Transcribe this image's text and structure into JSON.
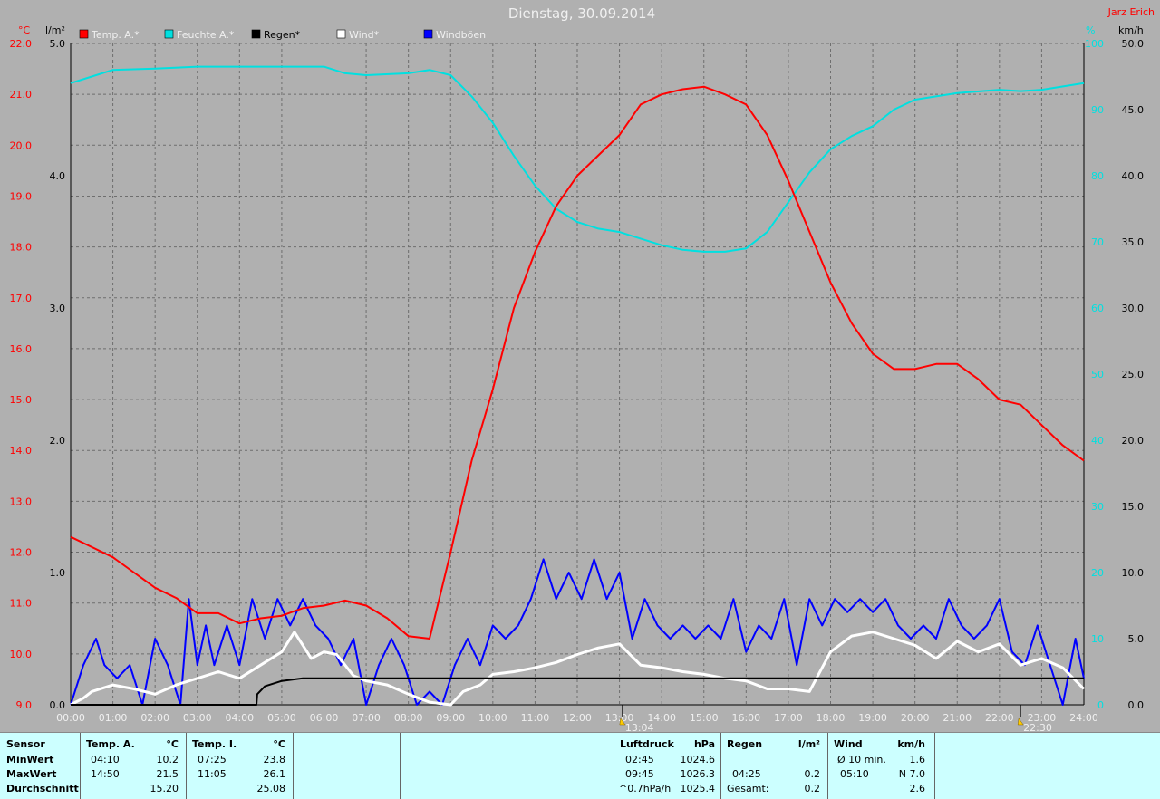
{
  "title": "Dienstag, 30.09.2014",
  "author": "Jarz Erich",
  "axes": {
    "left_unit": "°C",
    "left2_unit": "l/m²",
    "right_unit": "%",
    "right2_unit": "km/h",
    "temp_ticks": [
      "22.0",
      "21.0",
      "20.0",
      "19.0",
      "18.0",
      "17.0",
      "16.0",
      "15.0",
      "14.0",
      "13.0",
      "12.0",
      "11.0",
      "10.0",
      "9.0"
    ],
    "rain_ticks": [
      "5.0",
      "4.0",
      "3.0",
      "2.0",
      "1.0",
      "0.0"
    ],
    "hum_ticks": [
      "100",
      "90",
      "80",
      "70",
      "60",
      "50",
      "40",
      "30",
      "20",
      "10",
      "0"
    ],
    "wind_ticks": [
      "50.0",
      "45.0",
      "40.0",
      "35.0",
      "30.0",
      "25.0",
      "20.0",
      "15.0",
      "10.0",
      "5.0",
      "0.0"
    ],
    "time_ticks": [
      "00:00",
      "01:00",
      "02:00",
      "03:00",
      "04:00",
      "05:00",
      "06:00",
      "07:00",
      "08:00",
      "09:00",
      "10:00",
      "11:00",
      "12:00",
      "13:00",
      "14:00",
      "15:00",
      "16:00",
      "17:00",
      "18:00",
      "19:00",
      "20:00",
      "21:00",
      "22:00",
      "23:00",
      "24:00"
    ]
  },
  "markers": [
    {
      "time": 13.07,
      "label": "13:04"
    },
    {
      "time": 22.5,
      "label": "22:30"
    }
  ],
  "chart_data": {
    "type": "line",
    "title": "Dienstag, 30.09.2014",
    "x_unit": "hours",
    "xlim": [
      0,
      24
    ],
    "grid": true,
    "legend_position": "top",
    "series": [
      {
        "name": "Temp. A.*",
        "axis": "temp",
        "color": "#ff0000",
        "range": [
          9,
          22
        ],
        "points": [
          [
            0,
            12.3
          ],
          [
            0.5,
            12.1
          ],
          [
            1,
            11.9
          ],
          [
            1.5,
            11.6
          ],
          [
            2,
            11.3
          ],
          [
            2.5,
            11.1
          ],
          [
            3,
            10.8
          ],
          [
            3.5,
            10.8
          ],
          [
            4,
            10.6
          ],
          [
            4.5,
            10.7
          ],
          [
            5,
            10.75
          ],
          [
            5.5,
            10.9
          ],
          [
            6,
            10.95
          ],
          [
            6.5,
            11.05
          ],
          [
            7,
            10.95
          ],
          [
            7.5,
            10.7
          ],
          [
            8,
            10.35
          ],
          [
            8.5,
            10.3
          ],
          [
            9,
            12.0
          ],
          [
            9.5,
            13.8
          ],
          [
            10,
            15.2
          ],
          [
            10.5,
            16.8
          ],
          [
            11,
            17.9
          ],
          [
            11.5,
            18.8
          ],
          [
            12,
            19.4
          ],
          [
            12.5,
            19.8
          ],
          [
            13,
            20.2
          ],
          [
            13.5,
            20.8
          ],
          [
            14,
            21.0
          ],
          [
            14.5,
            21.1
          ],
          [
            15,
            21.15
          ],
          [
            15.5,
            21.0
          ],
          [
            16,
            20.8
          ],
          [
            16.5,
            20.2
          ],
          [
            17,
            19.3
          ],
          [
            17.5,
            18.3
          ],
          [
            18,
            17.3
          ],
          [
            18.5,
            16.5
          ],
          [
            19,
            15.9
          ],
          [
            19.5,
            15.6
          ],
          [
            20,
            15.6
          ],
          [
            20.5,
            15.7
          ],
          [
            21,
            15.7
          ],
          [
            21.5,
            15.4
          ],
          [
            22,
            15.0
          ],
          [
            22.5,
            14.9
          ],
          [
            23,
            14.5
          ],
          [
            23.5,
            14.1
          ],
          [
            24,
            13.8
          ]
        ]
      },
      {
        "name": "Feuchte A.*",
        "axis": "hum",
        "color": "#00e0e0",
        "range": [
          0,
          100
        ],
        "points": [
          [
            0,
            94
          ],
          [
            0.5,
            95
          ],
          [
            1,
            96
          ],
          [
            2,
            96.2
          ],
          [
            3,
            96.5
          ],
          [
            4,
            96.5
          ],
          [
            5,
            96.5
          ],
          [
            6,
            96.5
          ],
          [
            6.5,
            95.5
          ],
          [
            7,
            95.2
          ],
          [
            8,
            95.5
          ],
          [
            8.5,
            96
          ],
          [
            9,
            95.2
          ],
          [
            9.5,
            92
          ],
          [
            10,
            88
          ],
          [
            10.5,
            83
          ],
          [
            11,
            78.5
          ],
          [
            11.5,
            75
          ],
          [
            12,
            73
          ],
          [
            12.5,
            72
          ],
          [
            13,
            71.5
          ],
          [
            13.5,
            70.5
          ],
          [
            14,
            69.5
          ],
          [
            14.5,
            68.8
          ],
          [
            15,
            68.5
          ],
          [
            15.5,
            68.5
          ],
          [
            16,
            69
          ],
          [
            16.5,
            71.5
          ],
          [
            17,
            76
          ],
          [
            17.5,
            80.5
          ],
          [
            18,
            84
          ],
          [
            18.5,
            86
          ],
          [
            19,
            87.5
          ],
          [
            19.5,
            90
          ],
          [
            20,
            91.5
          ],
          [
            21,
            92.5
          ],
          [
            22,
            93
          ],
          [
            22.5,
            92.8
          ],
          [
            23,
            93
          ],
          [
            24,
            94
          ]
        ]
      },
      {
        "name": "Regen*",
        "axis": "rain",
        "color": "#000000",
        "range": [
          0,
          5
        ],
        "points": [
          [
            0,
            0
          ],
          [
            4.4,
            0
          ],
          [
            4.42,
            0.08
          ],
          [
            4.6,
            0.14
          ],
          [
            5,
            0.18
          ],
          [
            5.5,
            0.2
          ],
          [
            24,
            0.2
          ]
        ]
      },
      {
        "name": "Wind*",
        "axis": "wind",
        "color": "#ffffff",
        "range": [
          0,
          50
        ],
        "points": [
          [
            0,
            0
          ],
          [
            0.3,
            0.5
          ],
          [
            0.5,
            1
          ],
          [
            1,
            1.5
          ],
          [
            1.5,
            1.2
          ],
          [
            2,
            0.8
          ],
          [
            2.5,
            1.5
          ],
          [
            3,
            2
          ],
          [
            3.5,
            2.5
          ],
          [
            4,
            2
          ],
          [
            4.5,
            3
          ],
          [
            5,
            4
          ],
          [
            5.3,
            5.5
          ],
          [
            5.7,
            3.5
          ],
          [
            6,
            4
          ],
          [
            6.3,
            3.8
          ],
          [
            6.7,
            2.2
          ],
          [
            7,
            1.8
          ],
          [
            7.5,
            1.5
          ],
          [
            8,
            0.8
          ],
          [
            8.5,
            0.2
          ],
          [
            9,
            0
          ],
          [
            9.3,
            1
          ],
          [
            9.7,
            1.5
          ],
          [
            10,
            2.3
          ],
          [
            10.5,
            2.5
          ],
          [
            11,
            2.8
          ],
          [
            11.5,
            3.2
          ],
          [
            12,
            3.8
          ],
          [
            12.5,
            4.3
          ],
          [
            13,
            4.6
          ],
          [
            13.5,
            3
          ],
          [
            14,
            2.8
          ],
          [
            14.5,
            2.5
          ],
          [
            15,
            2.3
          ],
          [
            15.5,
            2
          ],
          [
            16,
            1.8
          ],
          [
            16.5,
            1.2
          ],
          [
            17,
            1.2
          ],
          [
            17.5,
            1
          ],
          [
            18,
            4
          ],
          [
            18.5,
            5.2
          ],
          [
            19,
            5.5
          ],
          [
            19.5,
            5
          ],
          [
            20,
            4.5
          ],
          [
            20.5,
            3.5
          ],
          [
            21,
            4.8
          ],
          [
            21.5,
            4
          ],
          [
            22,
            4.6
          ],
          [
            22.5,
            3
          ],
          [
            23,
            3.5
          ],
          [
            23.5,
            2.8
          ],
          [
            24,
            1.2
          ]
        ]
      },
      {
        "name": "Windböen",
        "axis": "wind",
        "color": "#0000ff",
        "range": [
          0,
          50
        ],
        "points": [
          [
            0,
            0
          ],
          [
            0.3,
            3
          ],
          [
            0.6,
            5
          ],
          [
            0.8,
            3
          ],
          [
            1.1,
            2
          ],
          [
            1.4,
            3
          ],
          [
            1.7,
            0
          ],
          [
            2.0,
            5
          ],
          [
            2.3,
            3
          ],
          [
            2.6,
            0
          ],
          [
            2.8,
            8
          ],
          [
            3.0,
            3
          ],
          [
            3.2,
            6
          ],
          [
            3.4,
            3
          ],
          [
            3.7,
            6
          ],
          [
            4.0,
            3
          ],
          [
            4.3,
            8
          ],
          [
            4.6,
            5
          ],
          [
            4.9,
            8
          ],
          [
            5.2,
            6
          ],
          [
            5.5,
            8
          ],
          [
            5.8,
            6
          ],
          [
            6.1,
            5
          ],
          [
            6.4,
            3
          ],
          [
            6.7,
            5
          ],
          [
            7.0,
            0
          ],
          [
            7.3,
            3
          ],
          [
            7.6,
            5
          ],
          [
            7.9,
            3
          ],
          [
            8.2,
            0
          ],
          [
            8.5,
            1
          ],
          [
            8.8,
            0
          ],
          [
            9.1,
            3
          ],
          [
            9.4,
            5
          ],
          [
            9.7,
            3
          ],
          [
            10.0,
            6
          ],
          [
            10.3,
            5
          ],
          [
            10.6,
            6
          ],
          [
            10.9,
            8
          ],
          [
            11.2,
            11
          ],
          [
            11.5,
            8
          ],
          [
            11.8,
            10
          ],
          [
            12.1,
            8
          ],
          [
            12.4,
            11
          ],
          [
            12.7,
            8
          ],
          [
            13.0,
            10
          ],
          [
            13.3,
            5
          ],
          [
            13.6,
            8
          ],
          [
            13.9,
            6
          ],
          [
            14.2,
            5
          ],
          [
            14.5,
            6
          ],
          [
            14.8,
            5
          ],
          [
            15.1,
            6
          ],
          [
            15.4,
            5
          ],
          [
            15.7,
            8
          ],
          [
            16.0,
            4
          ],
          [
            16.3,
            6
          ],
          [
            16.6,
            5
          ],
          [
            16.9,
            8
          ],
          [
            17.2,
            3
          ],
          [
            17.5,
            8
          ],
          [
            17.8,
            6
          ],
          [
            18.1,
            8
          ],
          [
            18.4,
            7
          ],
          [
            18.7,
            8
          ],
          [
            19.0,
            7
          ],
          [
            19.3,
            8
          ],
          [
            19.6,
            6
          ],
          [
            19.9,
            5
          ],
          [
            20.2,
            6
          ],
          [
            20.5,
            5
          ],
          [
            20.8,
            8
          ],
          [
            21.1,
            6
          ],
          [
            21.4,
            5
          ],
          [
            21.7,
            6
          ],
          [
            22.0,
            8
          ],
          [
            22.3,
            4
          ],
          [
            22.6,
            3
          ],
          [
            22.9,
            6
          ],
          [
            23.2,
            3
          ],
          [
            23.5,
            0
          ],
          [
            23.8,
            5
          ],
          [
            24,
            2
          ]
        ]
      }
    ]
  },
  "table": {
    "sensor": {
      "header": "Sensor",
      "rows": [
        "MinWert",
        "MaxWert",
        "Durchschnitt"
      ]
    },
    "temp_a": {
      "header": "Temp. A.",
      "unit": "°C",
      "min_time": "04:10",
      "min_val": "10.2",
      "max_time": "14:50",
      "max_val": "21.5",
      "avg": "15.20"
    },
    "temp_i": {
      "header": "Temp. I.",
      "unit": "°C",
      "min_time": "07:25",
      "min_val": "23.8",
      "max_time": "11:05",
      "max_val": "26.1",
      "avg": "25.08"
    },
    "pressure": {
      "header": "Luftdruck",
      "unit": "hPa",
      "min_time": "02:45",
      "min_val": "1024.6",
      "max_time": "09:45",
      "max_val": "1026.3",
      "trend": "^0.7hPa/h",
      "avg": "1025.4"
    },
    "rain": {
      "header": "Regen",
      "unit": "l/m²",
      "max_time": "04:25",
      "max_val": "0.2",
      "total_label": "Gesamt:",
      "total": "0.2"
    },
    "wind": {
      "header": "Wind",
      "unit": "km/h",
      "avg_label": "Ø 10 min.",
      "avg_val": "1.6",
      "max_time": "05:10",
      "max_val": "N 7.0",
      "avg": "2.6"
    }
  }
}
